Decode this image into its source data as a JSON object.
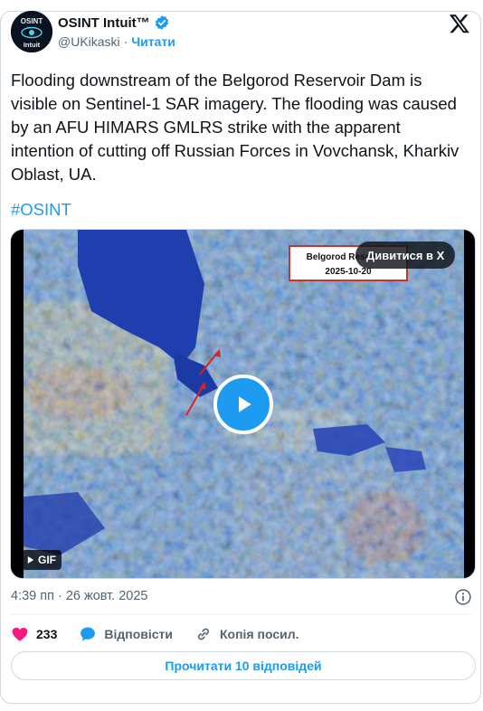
{
  "author": {
    "name": "OSINT Intuit™",
    "handle": "@UKikaski",
    "separator": "·",
    "follow_label": "Читати",
    "avatar_text_top": "OSINT",
    "avatar_text_bottom": "Intuit"
  },
  "tweet": {
    "text": "Flooding downstream of the Belgorod Reservoir Dam is visible on Sentinel-1 SAR imagery. The flooding was caused by an AFU HIMARS GMLRS strike with the apparent intention of cutting off Russian Forces in Vovchansk, Kharkiv Oblast, UA.",
    "hashtag": "#OSINT"
  },
  "media": {
    "overlay_line1": "Belgorod Reservoir",
    "overlay_line2": "2025-10-20",
    "watch_label": "Дивитися в X",
    "gif_label": "GIF"
  },
  "meta": {
    "timestamp": "4:39 пп · 26 жовт. 2025"
  },
  "actions": {
    "like_count": "233",
    "reply_label": "Відповісти",
    "copy_label": "Копія посил."
  },
  "read_replies_label": "Прочитати 10 відповідей",
  "colors": {
    "accent": "#1d9bf0",
    "like": "#f91880",
    "text": "#0f1419",
    "muted": "#536471"
  }
}
